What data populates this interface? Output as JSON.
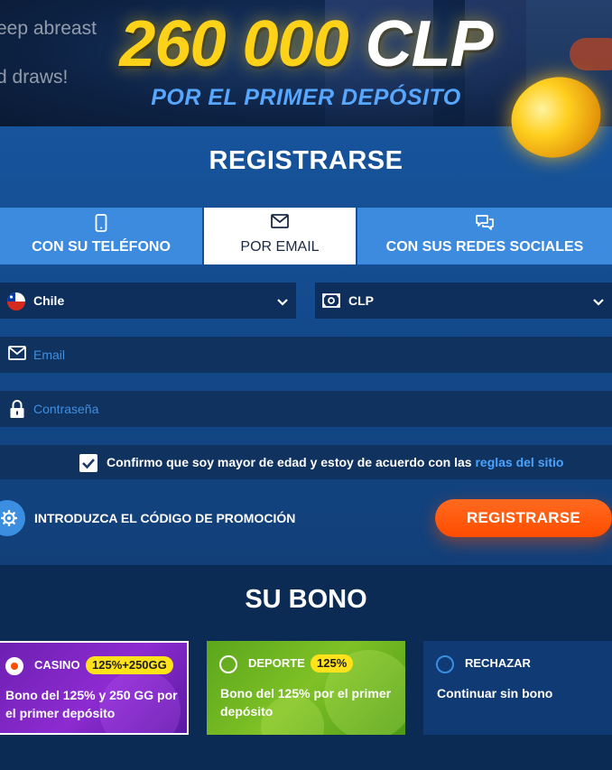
{
  "hero": {
    "bg_text_lines": [
      "eep abreast",
      "d draws!"
    ],
    "amount": "260 000",
    "currency": "CLP",
    "subtitle": "POR EL PRIMER DEPÓSITO"
  },
  "registration": {
    "title": "REGISTRARSE",
    "tabs": [
      {
        "label": "CON SU TELÉFONO",
        "icon": "phone-icon",
        "active": false
      },
      {
        "label": "POR EMAIL",
        "icon": "envelope-icon",
        "active": true
      },
      {
        "label": "CON SUS REDES SOCIALES",
        "icon": "chat-bubbles-icon",
        "active": false
      }
    ],
    "country": {
      "value": "Chile",
      "icon": "chile-flag-icon"
    },
    "currency": {
      "value": "CLP",
      "icon": "banknote-icon"
    },
    "email": {
      "placeholder": "Email",
      "value": ""
    },
    "password": {
      "placeholder": "Contraseña",
      "value": ""
    },
    "consent": {
      "checked": true,
      "text": "Confirmo que soy mayor de edad y estoy de acuerdo con las",
      "link": "reglas del sitio"
    },
    "promo_label": "INTRODUZCA EL CÓDIGO DE PROMOCIÓN",
    "submit_label": "REGISTRARSE"
  },
  "bonus": {
    "title": "SU BONO",
    "options": [
      {
        "name": "CASINO",
        "badge": "125%+250GG",
        "description": "Bono del 125% y 250 GG por el primer depósito",
        "selected": true
      },
      {
        "name": "DEPORTE",
        "badge": "125%",
        "description": "Bono del 125% por el primer depósito",
        "selected": false
      },
      {
        "name": "RECHAZAR",
        "badge": "",
        "description": "Continuar sin bono",
        "selected": false
      }
    ]
  },
  "colors": {
    "accent_orange": "#ff4d00",
    "accent_blue": "#3c8bde",
    "gold": "#ffd21a",
    "link_blue": "#4aa3ff",
    "casino_purple": "#8d2bd0",
    "sport_green": "#7fc126"
  }
}
